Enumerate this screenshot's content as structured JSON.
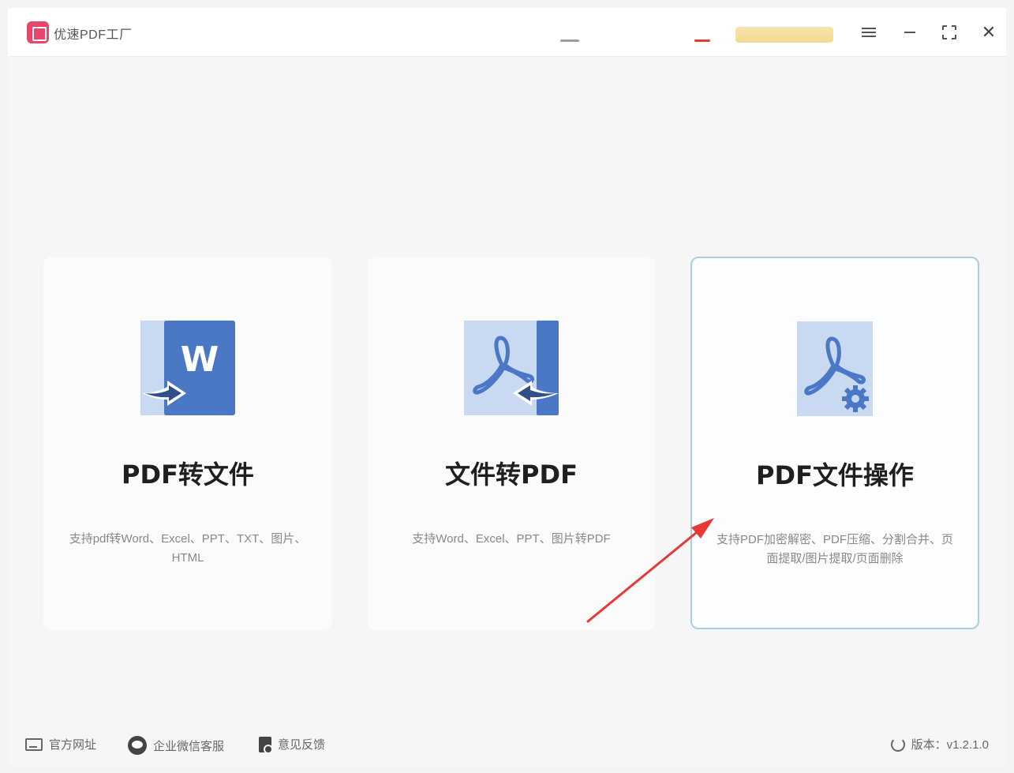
{
  "titlebar": {
    "app_title": "优速PDF工厂",
    "menu_icon": "hamburger-menu-icon",
    "minimize_icon": "minimize-icon",
    "maximize_icon": "maximize-icon",
    "close_icon": "close-icon",
    "close_label": "✕"
  },
  "cards": [
    {
      "title": "PDF转文件",
      "desc": "支持pdf转Word、Excel、PPT、TXT、图片、HTML",
      "icon": "pdf-to-word-icon",
      "selected": false
    },
    {
      "title": "文件转PDF",
      "desc": "支持Word、Excel、PPT、图片转PDF",
      "icon": "file-to-pdf-icon",
      "selected": false
    },
    {
      "title": "PDF文件操作",
      "desc": "支持PDF加密解密、PDF压缩、分割合并、页面提取/图片提取/页面删除",
      "icon": "pdf-settings-icon",
      "selected": true
    }
  ],
  "footer": {
    "website": "官方网址",
    "wechat": "企业微信客服",
    "feedback": "意见反馈",
    "version": "版本：v1.2.1.0"
  },
  "colors": {
    "brand": "#e8456a",
    "icon_dark": "#4a78c4",
    "icon_light": "#c9d9f2",
    "selected_border": "#a9cde8",
    "annotation_arrow": "#e53935"
  }
}
